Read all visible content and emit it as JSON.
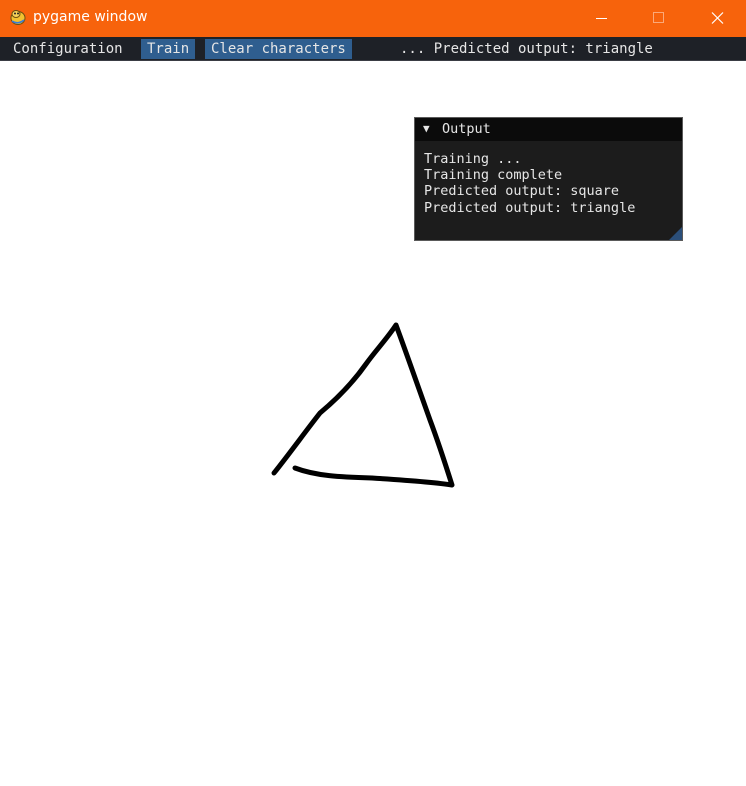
{
  "window": {
    "title": "pygame window",
    "icon": "pygame-snake-icon",
    "controls": [
      "minimize-icon",
      "maximize-icon",
      "close-icon"
    ],
    "colors": {
      "titlebar": "#f7630c",
      "menubar": "#1e2127",
      "highlight": "#2f5e8f"
    }
  },
  "menu": {
    "configuration": "Configuration",
    "train": "Train",
    "clear": "Clear characters",
    "status": "... Predicted output: triangle"
  },
  "output_panel": {
    "collapse_glyph": "▼",
    "title": "Output",
    "lines": [
      "Training ...",
      "Training complete",
      "Predicted output: square",
      "Predicted output: triangle"
    ]
  },
  "canvas": {
    "drawn_shape": "triangle",
    "stroke_color": "#000000"
  }
}
